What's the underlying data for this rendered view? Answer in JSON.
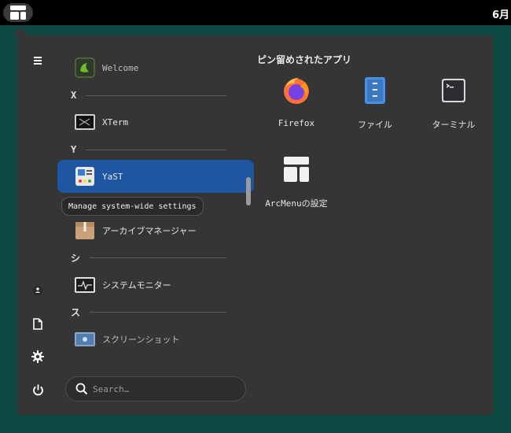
{
  "topbar": {
    "clock": "6月",
    "arcmenu_icon": "arcmenu-layout-icon"
  },
  "sidebar": {
    "buttons": [
      {
        "name": "hamburger-icon"
      },
      {
        "name": "home-icon"
      },
      {
        "name": "documents-icon"
      },
      {
        "name": "settings-icon"
      },
      {
        "name": "power-icon"
      }
    ]
  },
  "applist": {
    "sections": [
      {
        "id": "x",
        "letter": "X"
      },
      {
        "id": "y",
        "letter": "Y"
      },
      {
        "id": "shi",
        "letter": "シ"
      },
      {
        "id": "su",
        "letter": "ス"
      }
    ],
    "items": [
      {
        "id": "welcome",
        "label": "Welcome",
        "icon": "welcome-icon"
      },
      {
        "id": "xterm",
        "label": "XTerm",
        "icon": "xterm-icon"
      },
      {
        "id": "yast",
        "label": "YaST",
        "icon": "yast-icon",
        "selected": true
      },
      {
        "id": "archive",
        "label": "アーカイブマネージャー",
        "icon": "archive-manager-icon"
      },
      {
        "id": "sysmon",
        "label": "システムモニター",
        "icon": "system-monitor-icon"
      },
      {
        "id": "screenshot",
        "label": "スクリーンショット",
        "icon": "screenshot-icon"
      }
    ],
    "tooltip": "Manage system-wide settings"
  },
  "search": {
    "placeholder": "Search…",
    "value": ""
  },
  "pinned": {
    "title": "ピン留めされたアプリ",
    "apps": [
      {
        "id": "firefox",
        "label": "Firefox",
        "icon": "firefox-icon"
      },
      {
        "id": "files",
        "label": "ファイル",
        "icon": "files-icon"
      },
      {
        "id": "terminal",
        "label": "ターミナル",
        "icon": "terminal-icon"
      },
      {
        "id": "arcsettings",
        "label": "ArcMenuの設定",
        "icon": "arcmenu-settings-icon"
      }
    ]
  },
  "colors": {
    "panel": "#353535",
    "desktop": "#0d4842",
    "selection": "#1f56a4"
  }
}
